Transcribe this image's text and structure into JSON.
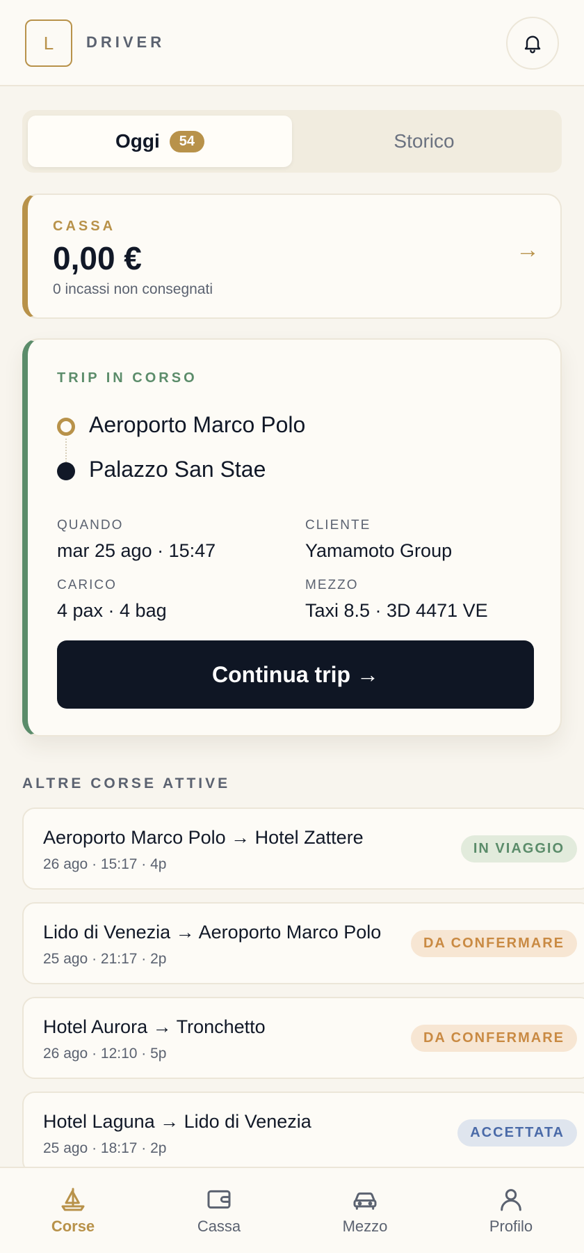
{
  "header": {
    "logo_letter": "L",
    "app_name": "DRIVER",
    "bell_icon": "bell-icon"
  },
  "tabs": [
    {
      "label": "Oggi",
      "count": "54",
      "active": true
    },
    {
      "label": "Storico",
      "active": false
    }
  ],
  "cassa": {
    "label": "CASSA",
    "amount": "0,00 €",
    "subtitle": "0 incassi non consegnati",
    "arrow": "→"
  },
  "trip": {
    "label": "TRIP IN CORSO",
    "origin": "Aeroporto Marco Polo",
    "destination": "Palazzo San Stae",
    "quando_label": "QUANDO",
    "quando_value": "mar 25 ago · 15:47",
    "cliente_label": "CLIENTE",
    "cliente_value": "Yamamoto Group",
    "carico_label": "CARICO",
    "carico_value": "4 pax · 4 bag",
    "mezzo_label": "MEZZO",
    "mezzo_value": "Taxi 8.5 · 3D 4471 VE",
    "button_label": "Continua trip →"
  },
  "others": {
    "title": "ALTRE CORSE ATTIVE",
    "items": [
      {
        "title": "Aeroporto Marco Polo → Hotel Zattere",
        "meta": "26 ago · 15:17 · 4p",
        "status": "IN VIAGGIO",
        "status_color": "#5b8c6a"
      },
      {
        "title": "Lido di Venezia → Aeroporto Marco Polo",
        "meta": "25 ago · 21:17 · 2p",
        "status": "DA CONFERMARE",
        "status_color": "#c98a43"
      },
      {
        "title": "Hotel Aurora → Tronchetto",
        "meta": "26 ago · 12:10 · 5p",
        "status": "DA CONFERMARE",
        "status_color": "#c98a43"
      },
      {
        "title": "Hotel Laguna → Lido di Venezia",
        "meta": "25 ago · 18:17 · 2p",
        "status": "ACCETTATA",
        "status_color": "#4a6aa8"
      }
    ]
  },
  "nav": [
    {
      "label": "Corse",
      "icon": "boat-icon",
      "active": true
    },
    {
      "label": "Cassa",
      "icon": "wallet-icon",
      "active": false
    },
    {
      "label": "Mezzo",
      "icon": "car-icon",
      "active": false
    },
    {
      "label": "Profilo",
      "icon": "user-icon",
      "active": false
    }
  ],
  "colors": {
    "accent": "#b8924a",
    "success": "#5b8c6a",
    "dark": "#0f1624",
    "background": "#f8f5ee"
  }
}
